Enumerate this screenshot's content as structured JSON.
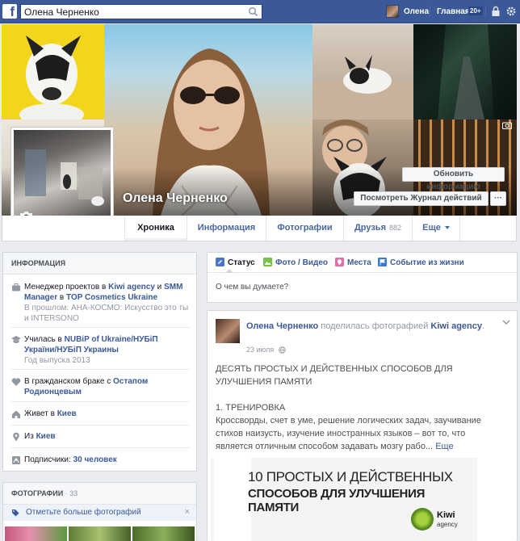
{
  "topbar": {
    "logo": "f",
    "search_value": "Олена Черненко",
    "user_name": "Олена",
    "home_label": "Главная",
    "home_badge": "20+"
  },
  "profile": {
    "name": "Олена Черненко",
    "update_info_button": "Обновить информацию",
    "activity_log_button": "Посмотреть Журнал действий",
    "more_button": "···"
  },
  "tabs": {
    "timeline": "Хроника",
    "about": "Информация",
    "photos": "Фотографии",
    "friends": "Друзья",
    "friends_count": "882",
    "more": "Еще"
  },
  "info": {
    "header": "Информация",
    "job": {
      "prefix": "Менеджер проектов в ",
      "company": "Kiwi agency",
      "mid": " и ",
      "role": "SMM Manager",
      "mid2": " в ",
      "company2": "TOP Cosmetics Ukraine",
      "past": "В прошлом: АНА-КОСМО: Искусство это ты и INTERSONO"
    },
    "study": {
      "prefix": "Училась в ",
      "school": "NUBiP of Ukraine/НУБіП України/НУБіП Украины",
      "year": "Год выпуска 2013"
    },
    "relationship": {
      "prefix": "В гражданском браке с ",
      "partner": "Остапом Родионцевым"
    },
    "lives": {
      "prefix": "Живет в ",
      "city": "Киев"
    },
    "from": {
      "prefix": "Из ",
      "city": "Киев"
    },
    "followers": {
      "prefix": "Подписчики: ",
      "count": "30 человек"
    }
  },
  "photos_card": {
    "header": "Фотографии",
    "separator": " · ",
    "count": "33",
    "tag_prompt": "Отметьте больше фотографий",
    "close": "×"
  },
  "composer": {
    "status": "Статус",
    "photo_video": "Фото / Видео",
    "place": "Места",
    "life_event": "Событие из жизни",
    "placeholder": "О чем вы думаете?"
  },
  "post": {
    "author": "Олена Черненко",
    "action": " поделилась фотографией ",
    "target": "Kiwi agency",
    "target_suffix": ".",
    "date": "23 июля",
    "text_heading": "ДЕСЯТЬ ПРОСТЫХ И ДЕЙСТВЕННЫХ СПОСОБОВ ДЛЯ УЛУЧШЕНИЯ ПАМЯТИ",
    "text_section": "1. ТРЕНИРОВКА",
    "text_body": "Кроссворды, счет в уме, решение логических задач, заучивание стихов наизусть, изучение иностранных языков – вот то, что является отличным способом задавать мозгу рабо...",
    "more_link": "Еще",
    "image_title_line1": "10 ПРОСТЫХ И ДЕЙСТВЕННЫХ",
    "image_title_line2": "СПОСОБОВ ДЛЯ УЛУЧШЕНИЯ ПАМЯТИ",
    "image_logo_kiwi": "Kiwi",
    "image_logo_agency": "agency"
  },
  "colors": {
    "brand": "#3b5998",
    "link": "#3b5998",
    "muted": "#9197a3",
    "background": "#e9ebee"
  },
  "icons": [
    "search-icon",
    "lock-icon",
    "gear-icon",
    "camera-icon",
    "briefcase-icon",
    "graduation-icon",
    "heart-icon",
    "house-icon",
    "location-pin-icon",
    "followers-icon",
    "tag-icon",
    "pencil-icon",
    "photo-icon",
    "place-icon",
    "life-event-icon",
    "globe-icon",
    "chevron-down-icon"
  ]
}
